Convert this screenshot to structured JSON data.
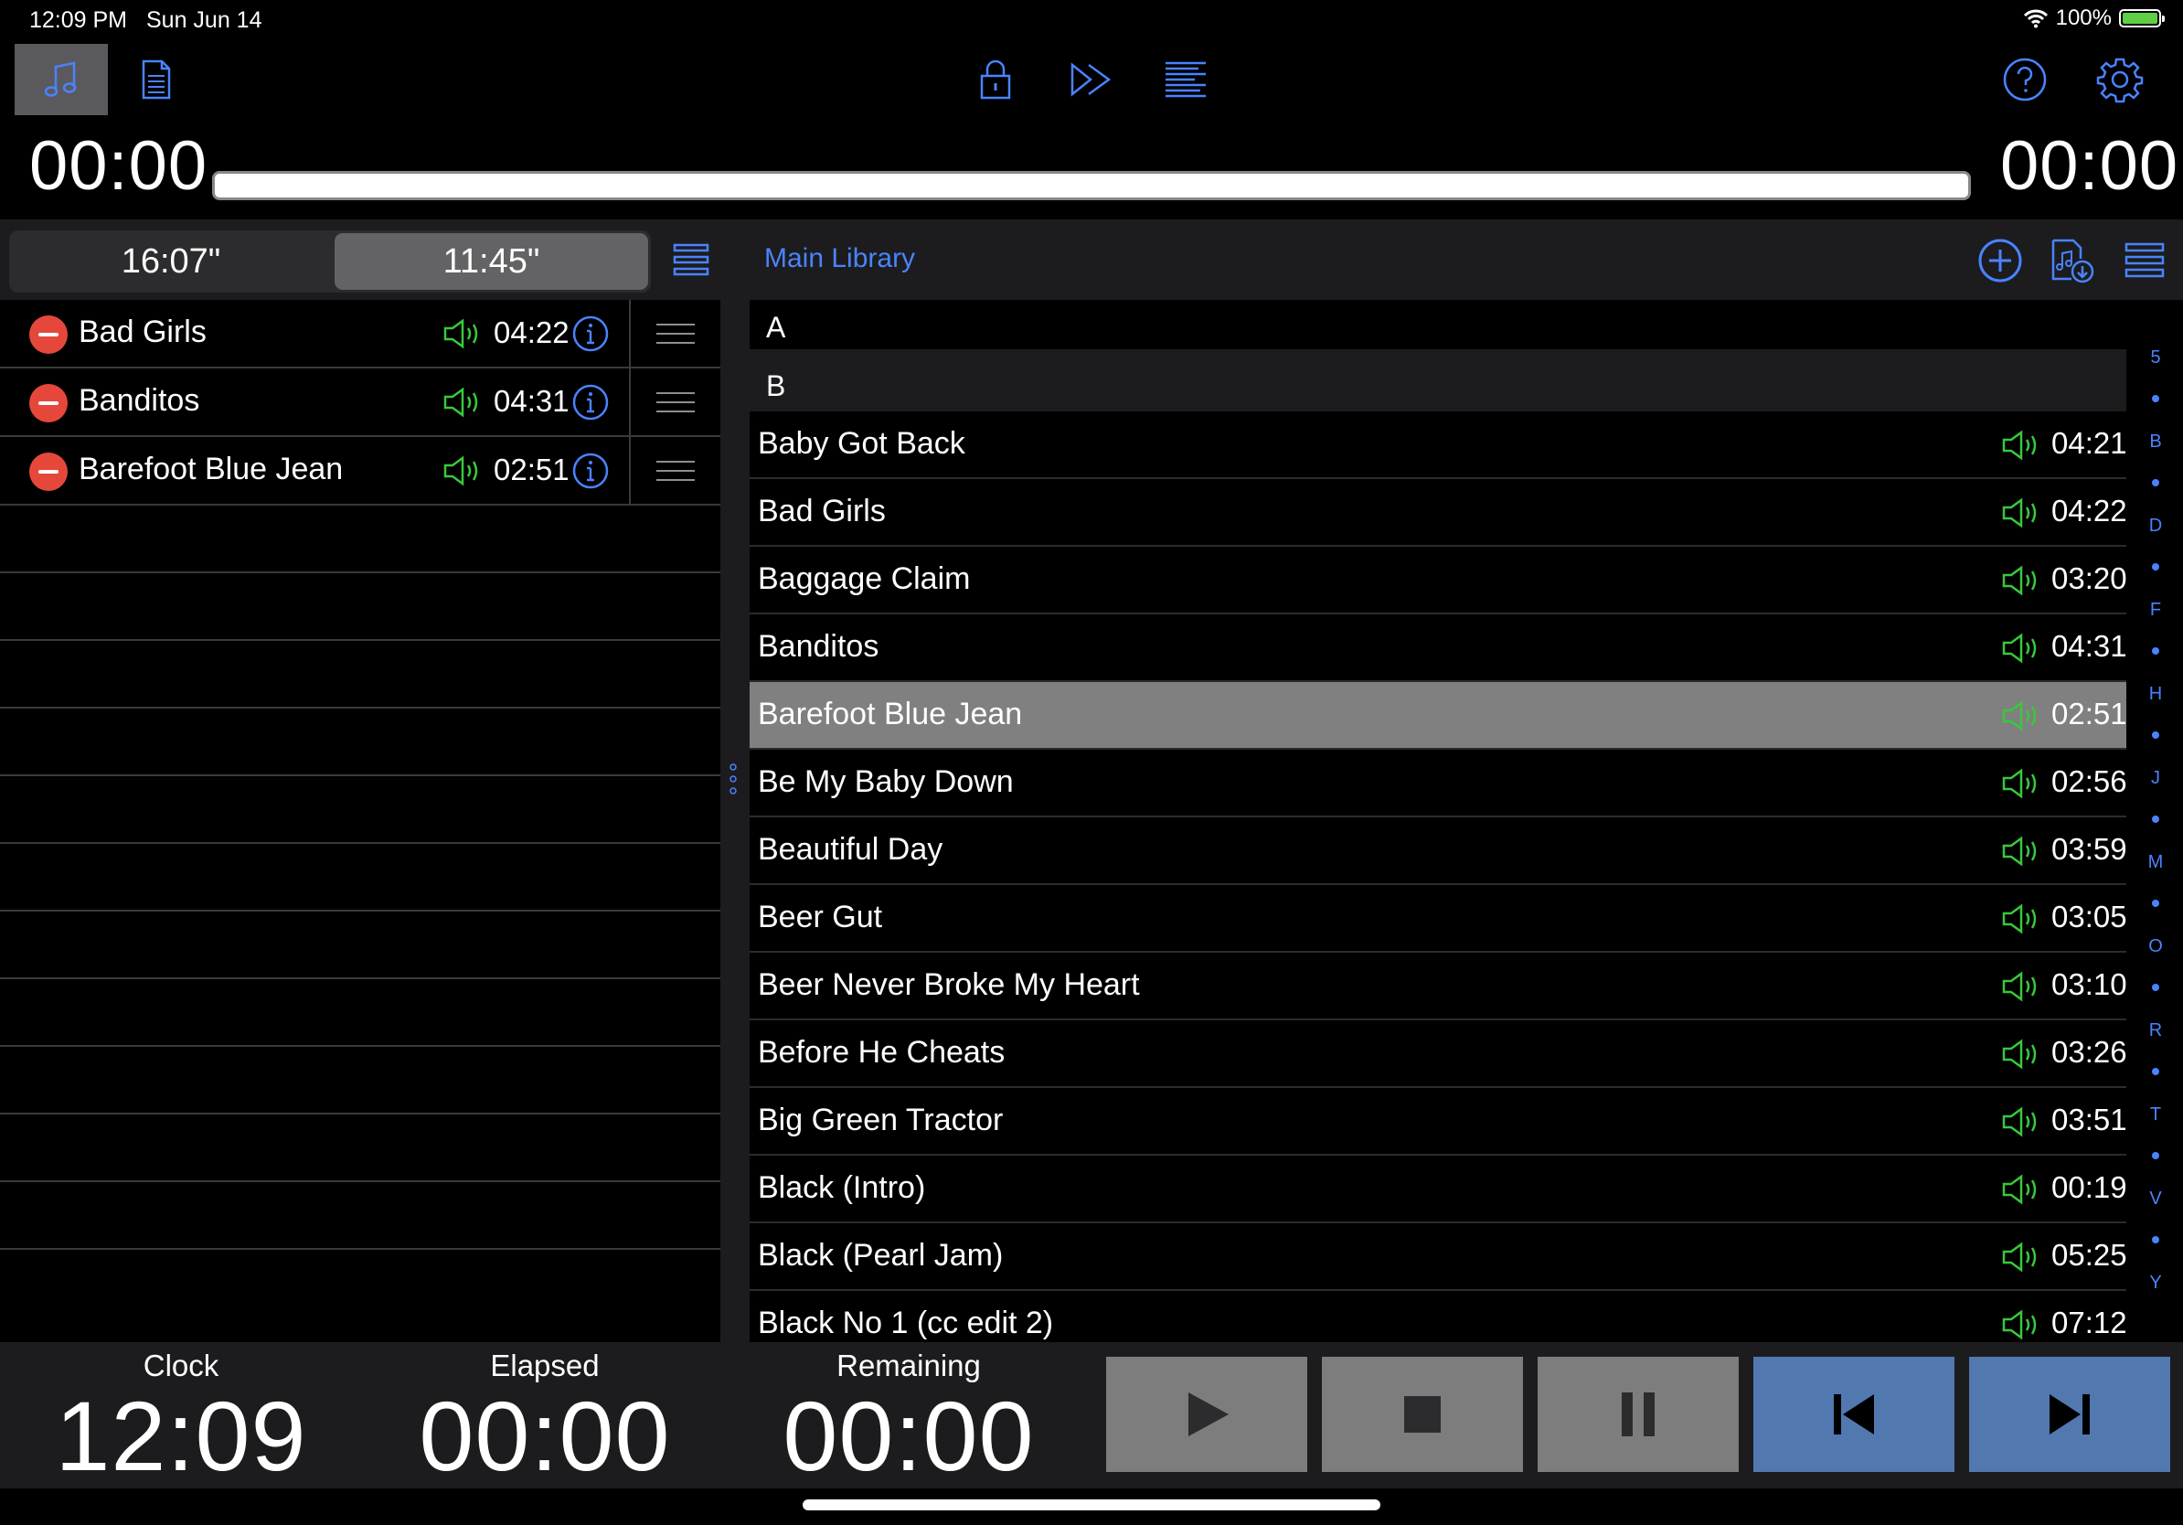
{
  "status": {
    "time": "12:09 PM",
    "date": "Sun Jun 14",
    "battery": "100%"
  },
  "toolbar": {
    "icons": [
      "music-note-icon",
      "document-icon",
      "lock-icon",
      "fast-forward-icon",
      "list-lines-icon",
      "help-icon",
      "gear-icon"
    ],
    "accent": "#4a83ff"
  },
  "player": {
    "elapsed": "00:00",
    "remaining": "00:00"
  },
  "setlist": {
    "segments": [
      "16:07\"",
      "11:45\""
    ],
    "active_segment": 1,
    "items": [
      {
        "title": "Bad Girls",
        "duration": "04:22"
      },
      {
        "title": "Banditos",
        "duration": "04:31"
      },
      {
        "title": "Barefoot Blue Jean",
        "duration": "02:51"
      }
    ]
  },
  "library": {
    "title": "Main Library",
    "sections": [
      "A",
      "B"
    ],
    "items": [
      {
        "title": "Baby Got Back",
        "duration": "04:21"
      },
      {
        "title": "Bad Girls",
        "duration": "04:22"
      },
      {
        "title": "Baggage Claim",
        "duration": "03:20"
      },
      {
        "title": "Banditos",
        "duration": "04:31"
      },
      {
        "title": "Barefoot Blue Jean",
        "duration": "02:51",
        "selected": true
      },
      {
        "title": "Be My Baby Down",
        "duration": "02:56"
      },
      {
        "title": "Beautiful Day",
        "duration": "03:59"
      },
      {
        "title": "Beer Gut",
        "duration": "03:05"
      },
      {
        "title": "Beer Never Broke My Heart",
        "duration": "03:10"
      },
      {
        "title": "Before He Cheats",
        "duration": "03:26"
      },
      {
        "title": "Big Green Tractor",
        "duration": "03:51"
      },
      {
        "title": "Black (Intro)",
        "duration": "00:19"
      },
      {
        "title": "Black (Pearl Jam)",
        "duration": "05:25"
      },
      {
        "title": "Black No 1 (cc edit 2)",
        "duration": "07:12"
      }
    ],
    "index": [
      "5",
      "B",
      "D",
      "F",
      "H",
      "J",
      "M",
      "O",
      "R",
      "T",
      "V",
      "Y"
    ]
  },
  "transport": {
    "clock_label": "Clock",
    "clock_value": "12:09",
    "elapsed_label": "Elapsed",
    "elapsed_value": "00:00",
    "remaining_label": "Remaining",
    "remaining_value": "00:00",
    "buttons": [
      "play-icon",
      "stop-icon",
      "pause-icon",
      "skip-back-icon",
      "skip-forward-icon"
    ]
  },
  "colors": {
    "speaker": "#38c93a",
    "minus": "#e5483b",
    "blue_button": "#5278b0"
  }
}
